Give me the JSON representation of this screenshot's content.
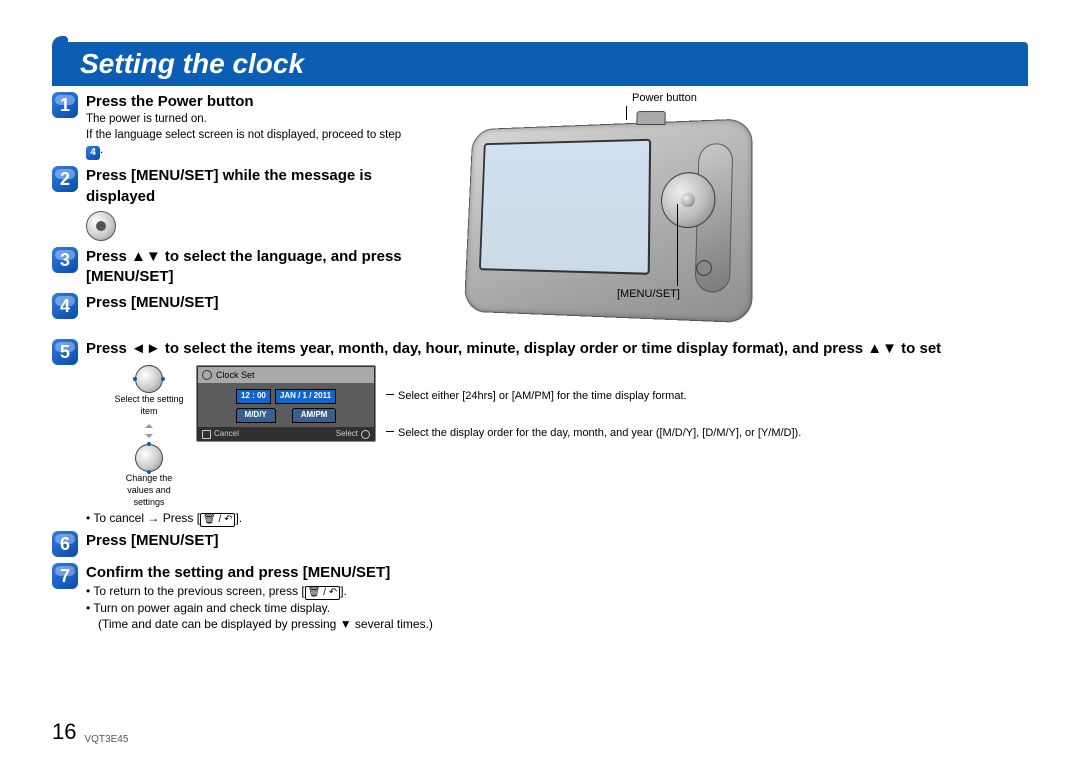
{
  "heading": "Setting the clock",
  "callouts": {
    "power_button": "Power button",
    "menu_set": "[MENU/SET]"
  },
  "steps": {
    "s1": {
      "n": "1",
      "title": "Press the Power button",
      "sub1": "The power is turned on.",
      "sub2_a": "If the language select screen is not displayed, proceed to step ",
      "sub2_badge": "4",
      "sub2_b": "."
    },
    "s2": {
      "n": "2",
      "title": "Press [MENU/SET] while the message is displayed"
    },
    "s3": {
      "n": "3",
      "title": "Press ▲▼ to select the language, and press [MENU/SET]"
    },
    "s4": {
      "n": "4",
      "title": "Press [MENU/SET]"
    },
    "s5": {
      "n": "5",
      "title": "Press ◄► to select the items year, month, day, hour, minute, display order or time display format), and press ▲▼ to set"
    },
    "s6": {
      "n": "6",
      "title": "Press [MENU/SET]"
    },
    "s7": {
      "n": "7",
      "title": "Confirm the setting and press [MENU/SET]"
    }
  },
  "step5": {
    "pad_label_top": "Select the setting item",
    "pad_label_bot": "Change the values and settings",
    "note_ampm": "Select either [24hrs] or [AM/PM] for the time display format.",
    "note_order": "Select the display order for the day, month, and year ([M/D/Y], [D/M/Y], or [Y/M/D]).",
    "cancel": "To cancel → Press [🗑 / ↶]."
  },
  "clockset": {
    "title": "Clock Set",
    "time": "12 : 00",
    "date": "JAN / 1 / 2011",
    "fmt1": "M/D/Y",
    "fmt2": "AM/PM",
    "cancel": "Cancel",
    "select": "Select"
  },
  "step7": {
    "b1_pre": "To return to the previous screen, press [",
    "b1_post": "].",
    "b2": "Turn on power again and check time display.",
    "b2_sub": "(Time and date can be displayed by pressing ▼ several times.)"
  },
  "footer": {
    "page": "16",
    "code": "VQT3E45"
  }
}
